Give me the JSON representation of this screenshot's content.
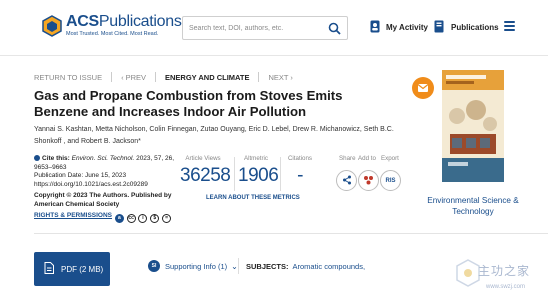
{
  "header": {
    "logo_brand": "ACS",
    "logo_name": "Publications",
    "logo_tagline": "Most Trusted. Most Cited. Most Read.",
    "search_placeholder": "Search text, DOI, authors, etc.",
    "my_activity": "My Activity",
    "publications": "Publications"
  },
  "nav": {
    "return": "RETURN TO ISSUE",
    "prev": "PREV",
    "section": "ENERGY AND CLIMATE",
    "next": "NEXT"
  },
  "article": {
    "title": "Gas and Propane Combustion from Stoves Emits Benzene and Increases Indoor Air Pollution",
    "authors": "Yannai S. Kashtan, Metta Nicholson, Colin Finnegan, Zutao Ouyang, Eric D. Lebel, Drew R. Michanowicz, Seth B.C. Shonkoff , and Robert B. Jackson*",
    "cite_label": "Cite this:",
    "cite_journal": "Environ. Sci. Technol.",
    "cite_detail": "2023, 57, 26, 9653–9663",
    "pub_date": "Publication Date: June 15, 2023",
    "doi": "https://doi.org/10.1021/acs.est.2c09289",
    "copyright": "Copyright © 2023 The Authors. Published by American Chemical Society",
    "rights": "RIGHTS & PERMISSIONS"
  },
  "metrics": {
    "views_label": "Article Views",
    "views": "36258",
    "altmetric_label": "Altmetric",
    "altmetric": "1906",
    "citations_label": "Citations",
    "citations": "-",
    "learn": "LEARN ABOUT THESE METRICS"
  },
  "actions": {
    "share": "Share",
    "add_to": "Add to",
    "export": "Export",
    "ris": "RIS"
  },
  "journal": {
    "name": "Environmental Science & Technology"
  },
  "bottom": {
    "pdf": "PDF (2 MB)",
    "si_badge": "SI",
    "supporting": "Supporting Info (1)",
    "subjects_label": "SUBJECTS:",
    "subjects_value": "Aromatic compounds,",
    "watermark": "主功之家",
    "watermark_url": "www.swzj.com"
  },
  "colors": {
    "brand_blue": "#1a4e8c",
    "accent_orange": "#f08c1a"
  }
}
